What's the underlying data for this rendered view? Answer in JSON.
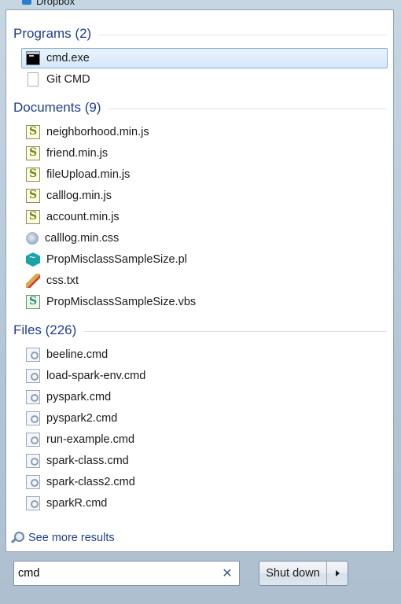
{
  "behind_window": {
    "label": "Dropbox"
  },
  "groups": {
    "programs": {
      "title": "Programs (2)",
      "items": [
        {
          "label": "cmd.exe",
          "icon": "cmd-exe-icon"
        },
        {
          "label": "Git CMD",
          "icon": "blank-document-icon"
        }
      ]
    },
    "documents": {
      "title": "Documents (9)",
      "items": [
        {
          "label": "neighborhood.min.js",
          "icon": "js-script-icon"
        },
        {
          "label": "friend.min.js",
          "icon": "js-script-icon"
        },
        {
          "label": "fileUpload.min.js",
          "icon": "js-script-icon"
        },
        {
          "label": "calllog.min.js",
          "icon": "js-script-icon"
        },
        {
          "label": "account.min.js",
          "icon": "js-script-icon"
        },
        {
          "label": "calllog.min.css",
          "icon": "css-file-icon"
        },
        {
          "label": "PropMisclassSampleSize.pl",
          "icon": "perl-file-icon"
        },
        {
          "label": "css.txt",
          "icon": "text-file-icon"
        },
        {
          "label": "PropMisclassSampleSize.vbs",
          "icon": "vbs-script-icon"
        }
      ]
    },
    "files": {
      "title": "Files (226)",
      "items": [
        {
          "label": "beeline.cmd",
          "icon": "cmd-file-icon"
        },
        {
          "label": "load-spark-env.cmd",
          "icon": "cmd-file-icon"
        },
        {
          "label": "pyspark.cmd",
          "icon": "cmd-file-icon"
        },
        {
          "label": "pyspark2.cmd",
          "icon": "cmd-file-icon"
        },
        {
          "label": "run-example.cmd",
          "icon": "cmd-file-icon"
        },
        {
          "label": "spark-class.cmd",
          "icon": "cmd-file-icon"
        },
        {
          "label": "spark-class2.cmd",
          "icon": "cmd-file-icon"
        },
        {
          "label": "sparkR.cmd",
          "icon": "cmd-file-icon"
        }
      ]
    }
  },
  "see_more": {
    "label": "See more results",
    "icon": "magnifier-icon"
  },
  "search": {
    "value": "cmd",
    "clear_icon": "clear-icon"
  },
  "shutdown": {
    "label": "Shut down",
    "arrow_icon": "arrow-right-icon"
  },
  "colors": {
    "header_text": "#1e3f8a",
    "selection_border": "#84acd9",
    "selection_bg": "#d5e8fb",
    "frame": "#b4c6d6"
  }
}
